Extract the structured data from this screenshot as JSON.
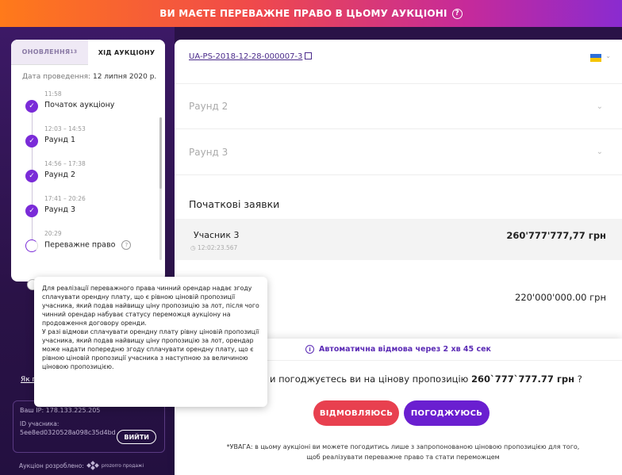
{
  "banner": {
    "text": "ВИ МАЄТЕ ПЕРЕВАЖНЕ ПРАВО В ЦЬОМУ АУКЦІОНІ",
    "help_icon": "question-circle-icon"
  },
  "sidebar": {
    "tabs": [
      {
        "label": "ОНОВЛЕННЯ",
        "badge": "13",
        "active": false
      },
      {
        "label": "ХІД АУКЦІОНУ",
        "active": true
      }
    ],
    "date_label": "Дата проведення:",
    "date_value": "12 липня 2020 р.",
    "timeline": [
      {
        "time": "11:58",
        "label": "Початок аукціону",
        "done": true
      },
      {
        "time": "12:03 – 14:53",
        "label": "Раунд 1",
        "done": true
      },
      {
        "time": "14:56 – 17:38",
        "label": "Раунд 2",
        "done": true
      },
      {
        "time": "17:41 – 20:26",
        "label": "Раунд 3",
        "done": true
      },
      {
        "time": "20:29",
        "label": "Переважне право",
        "done": false
      }
    ],
    "how_link": "Як п",
    "ip_label": "Ваш IP: 178.133.225.205",
    "id_label": "ID учасника:",
    "id_value": "5ee8ed0320528a098c35d4bd",
    "logout_label": "ВИЙТИ",
    "developed_by": "Аукціон розроблено:",
    "developer": "prozorro продажі"
  },
  "main": {
    "auction_id": "UA-PS-2018-12-28-000007-3",
    "rounds": [
      {
        "label": "Раунд 2"
      },
      {
        "label": "Раунд 3"
      }
    ],
    "initial_bids_title": "Початкові заявки",
    "bids": [
      {
        "name": "Учасник 3",
        "time": "12:02:23.567",
        "amount": "260'777'777,77 грн"
      },
      {
        "name": "",
        "time": "",
        "amount": "220'000'000.00 грн"
      }
    ]
  },
  "decision": {
    "auto_refusal": "Автоматична відмова через 2 хв 45 сек",
    "question_prefix": "и погоджуєтесь ви на цінову пропозицію",
    "question_amount": "260`777`777.77 грн",
    "question_suffix": "?",
    "decline_label": "ВІДМОВЛЯЮСЬ",
    "agree_label": "ПОГОДЖУЮСЬ",
    "warning": "*УВАГА: в цьому аукціоні ви можете погодитись лише з запропонованою ціновою пропозицією для того, щоб реалізувати переважне право та стати переможцем"
  },
  "tooltip": {
    "text1": "Для реалізації переважного права чинний орендар надає згоду сплачувати орендну плату, що є рівною ціновій пропозиції учасника, який подав найвищу ціну пропозицію за лот, після чого чинний орендар набуває статусу переможця аукціону на продовження договору оренди.",
    "text2": "У разі відмови сплачувати орендну плату рівну ціновій пропозиції учасника, який подав найвищу ціну пропозицію за лот, орендар може надати попередню згоду сплачувати орендну плату, що є рівною ціновій пропозиції учасника з наступною за величиною ціновою пропозицією."
  },
  "colors": {
    "accent": "#6a1fd0",
    "decline": "#e8404f",
    "sidebar_bg": "#2a1247"
  }
}
